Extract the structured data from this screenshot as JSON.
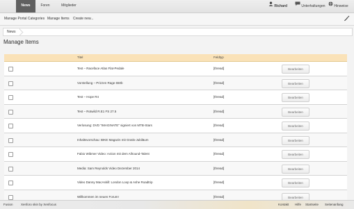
{
  "topbar": {
    "tabs": [
      {
        "label": "News",
        "active": true
      },
      {
        "label": "Foren"
      },
      {
        "label": "Mitglieder"
      }
    ],
    "user_name": "Richard",
    "conversations": "Unterhaltungen",
    "alerts": "Hinweise"
  },
  "subnav": {
    "links": [
      "Manage Portal Categories",
      "Manage Items",
      "Create new..."
    ]
  },
  "breadcrumb": "News",
  "page_title": "Manage Items",
  "table": {
    "headers": {
      "title": "Titel",
      "type": "Feldtyp"
    },
    "button_label": "Bearbeiten",
    "rows": [
      {
        "title": "Test – Raceface Atlas Flat-Pedale",
        "type": "[thread]"
      },
      {
        "title": "Vorstellung – Prizzen Rage 650b",
        "type": "[thread]"
      },
      {
        "title": "Test – Hope R4",
        "type": "[thread]"
      },
      {
        "title": "Test – Rotwild R.E1 FS 27.5",
        "type": "[thread]"
      },
      {
        "title": "Verlosung: DVD \"IMAGINATE\" signiert von MTB-Stars",
        "type": "[thread]"
      },
      {
        "title": "Inhaltsvorschau: BIKE Magazin mit Gratis-Jubiläum",
        "type": "[thread]"
      },
      {
        "title": "Fabio Wibmer Video: Action mit dem Allround-Talent",
        "type": "[thread]"
      },
      {
        "title": "Media: Sam Reynolds Video Dezember 2014",
        "type": "[thread]"
      },
      {
        "title": "Video Danny MacAskill: London Loop & Ashe Roadtrip",
        "type": "[thread]"
      },
      {
        "title": "Willkommen im neuen Forum!",
        "type": "[thread]"
      }
    ]
  },
  "footer": {
    "left": [
      "Fusion",
      "Xenforo skin by Xenfocus"
    ],
    "right": [
      "Kontakt",
      "Hilfe",
      "Startseite",
      "Seitenanfang"
    ]
  },
  "colors": {
    "active_tab": "#606060",
    "table_header": "#fae2b8"
  }
}
